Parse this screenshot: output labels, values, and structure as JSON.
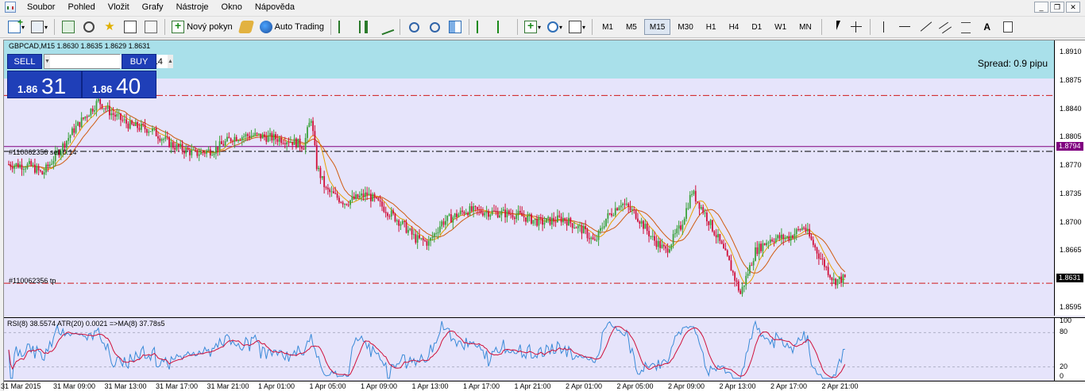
{
  "menu": [
    "Soubor",
    "Pohled",
    "Vložit",
    "Grafy",
    "Nástroje",
    "Okno",
    "Nápověda"
  ],
  "window_controls": [
    "_",
    "❐",
    "✕"
  ],
  "toolbar": {
    "new_order_label": "Nový pokyn",
    "auto_trading_label": "Auto Trading",
    "timeframes": [
      "M1",
      "M5",
      "M15",
      "M30",
      "H1",
      "H4",
      "D1",
      "W1",
      "MN"
    ],
    "active_timeframe": "M15",
    "text_tool": "A"
  },
  "chart": {
    "title": "GBPCAD,M15  1.8630 1.8635 1.8629 1.8631",
    "spread": "Spread: 0.9 pipu",
    "one_click": {
      "sell_label": "SELL",
      "buy_label": "BUY",
      "lot_value": "0.14",
      "sell_prefix": "1.86",
      "sell_big": "31",
      "buy_prefix": "1.86",
      "buy_big": "40"
    },
    "order_sell_label": "#110062356 sell 0.14",
    "order_tp_label": "#110062356 tp",
    "order_sell_price": "1.8794",
    "current_price": "1.8631",
    "price_ticks": [
      "1.8910",
      "1.8875",
      "1.8840",
      "1.8805",
      "1.8770",
      "1.8735",
      "1.8700",
      "1.8665",
      "1.8630",
      "1.8595"
    ],
    "indicator_title": "RSI(8) 38.5574  ATR(20) 0.0021  =>MA(8) 37.78s5",
    "indicator_ticks": [
      "100",
      "80",
      "20",
      "0"
    ],
    "time_ticks": [
      "31 Mar 2015",
      "31 Mar 09:00",
      "31 Mar 13:00",
      "31 Mar 17:00",
      "31 Mar 21:00",
      "1 Apr 01:00",
      "1 Apr 05:00",
      "1 Apr 09:00",
      "1 Apr 13:00",
      "1 Apr 17:00",
      "1 Apr 21:00",
      "2 Apr 01:00",
      "2 Apr 05:00",
      "2 Apr 09:00",
      "2 Apr 13:00",
      "2 Apr 17:00",
      "2 Apr 21:00"
    ],
    "colors": {
      "background": "#e6e4fb",
      "bull": "#3aa23a",
      "bear": "#d0103a",
      "ma_fast": "#e8a000",
      "ma_slow": "#d05a10",
      "order_line": "#800080",
      "tp_line": "#d01818",
      "rsi": "#3a8ad8",
      "rsi_ma": "#d0103a"
    }
  },
  "chart_data": {
    "type": "candlestick",
    "symbol": "GBPCAD",
    "timeframe": "M15",
    "ylim": [
      1.8585,
      1.8925
    ],
    "anchors": [
      [
        0,
        1.8772
      ],
      [
        12,
        1.877
      ],
      [
        18,
        1.876
      ],
      [
        26,
        1.8785
      ],
      [
        35,
        1.8815
      ],
      [
        48,
        1.885
      ],
      [
        55,
        1.8835
      ],
      [
        65,
        1.882
      ],
      [
        76,
        1.8815
      ],
      [
        88,
        1.8795
      ],
      [
        100,
        1.8785
      ],
      [
        110,
        1.879
      ],
      [
        120,
        1.8805
      ],
      [
        130,
        1.8808
      ],
      [
        140,
        1.8805
      ],
      [
        150,
        1.8802
      ],
      [
        158,
        1.8795
      ],
      [
        162,
        1.883
      ],
      [
        165,
        1.877
      ],
      [
        170,
        1.874
      ],
      [
        180,
        1.8725
      ],
      [
        192,
        1.8735
      ],
      [
        200,
        1.872
      ],
      [
        210,
        1.87
      ],
      [
        218,
        1.868
      ],
      [
        225,
        1.8675
      ],
      [
        232,
        1.87
      ],
      [
        245,
        1.8715
      ],
      [
        258,
        1.8713
      ],
      [
        272,
        1.871
      ],
      [
        285,
        1.87
      ],
      [
        297,
        1.8705
      ],
      [
        308,
        1.869
      ],
      [
        314,
        1.8675
      ],
      [
        320,
        1.8705
      ],
      [
        328,
        1.8725
      ],
      [
        336,
        1.871
      ],
      [
        345,
        1.868
      ],
      [
        352,
        1.8665
      ],
      [
        360,
        1.8695
      ],
      [
        366,
        1.8738
      ],
      [
        372,
        1.8715
      ],
      [
        380,
        1.868
      ],
      [
        386,
        1.865
      ],
      [
        392,
        1.8612
      ],
      [
        400,
        1.8665
      ],
      [
        408,
        1.868
      ],
      [
        418,
        1.8682
      ],
      [
        426,
        1.8695
      ],
      [
        434,
        1.866
      ],
      [
        442,
        1.8628
      ],
      [
        448,
        1.8631
      ]
    ]
  }
}
